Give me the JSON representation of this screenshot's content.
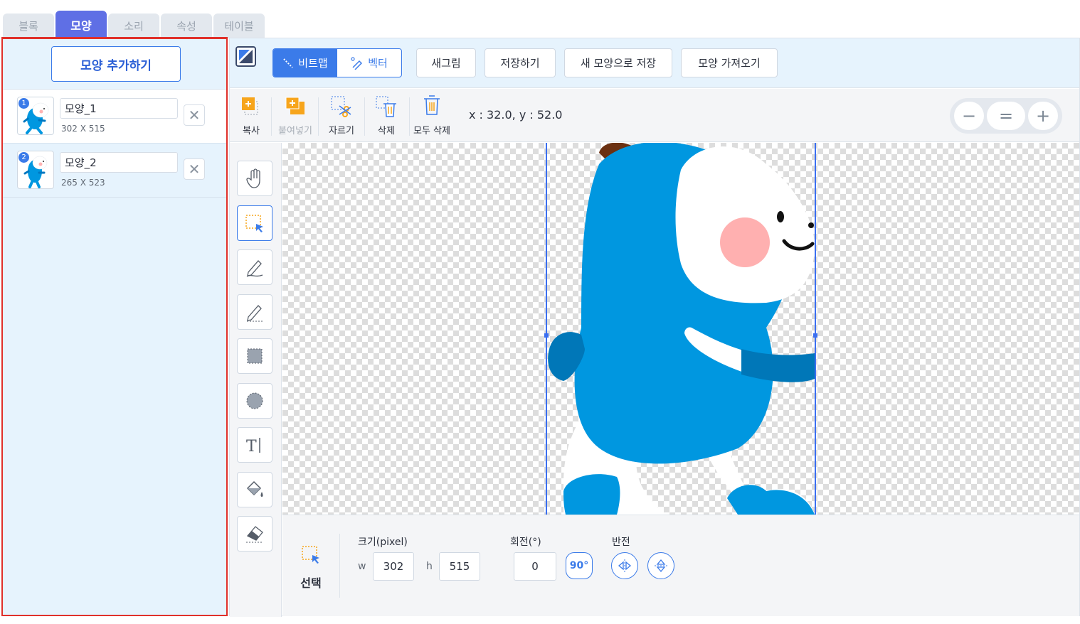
{
  "tabs": [
    {
      "label": "블록"
    },
    {
      "label": "모양"
    },
    {
      "label": "소리"
    },
    {
      "label": "속성"
    },
    {
      "label": "테이블"
    }
  ],
  "sidebar": {
    "add_label": "모양 추가하기",
    "pictures": [
      {
        "num": "1",
        "name": "모양_1",
        "size": "302 X 515"
      },
      {
        "num": "2",
        "name": "모양_2",
        "size": "265 X 523"
      }
    ]
  },
  "topbar": {
    "bitmap_label": "비트맵",
    "vector_label": "벡터",
    "new_label": "새그림",
    "save_label": "저장하기",
    "save_new_label": "새 모양으로 저장",
    "import_label": "모양 가져오기"
  },
  "edit_tools": {
    "copy": "복사",
    "paste": "붙여넣기",
    "cut": "자르기",
    "delete": "삭제",
    "delete_all": "모두 삭제"
  },
  "coords": "x : 32.0, y : 52.0",
  "zoom": {
    "out": "−",
    "reset": "=",
    "in": "+"
  },
  "bottom": {
    "tool_label": "선택",
    "size_label": "크기(pixel)",
    "w_label": "w",
    "h_label": "h",
    "w_value": "302",
    "h_value": "515",
    "rotate_label": "회전(°)",
    "rotate_value": "0",
    "rotate90": "90°",
    "flip_label": "반전"
  },
  "colors": {
    "accent": "#3b7be9",
    "active_tab": "#5f6fe5",
    "highlight_border": "#e0302a",
    "panel_bg": "#e6f3fd",
    "character_blue": "#0097e0"
  },
  "icons": [
    "bitmap-mode-icon",
    "pencil-line-icon",
    "copy-icon",
    "paste-icon",
    "scissors-icon",
    "trash-icon",
    "hand-icon",
    "select-icon",
    "pen-icon",
    "pencil-icon",
    "rect-icon",
    "circle-icon",
    "text-icon",
    "fill-icon",
    "eraser-icon",
    "flip-horizontal-icon",
    "flip-vertical-icon"
  ]
}
